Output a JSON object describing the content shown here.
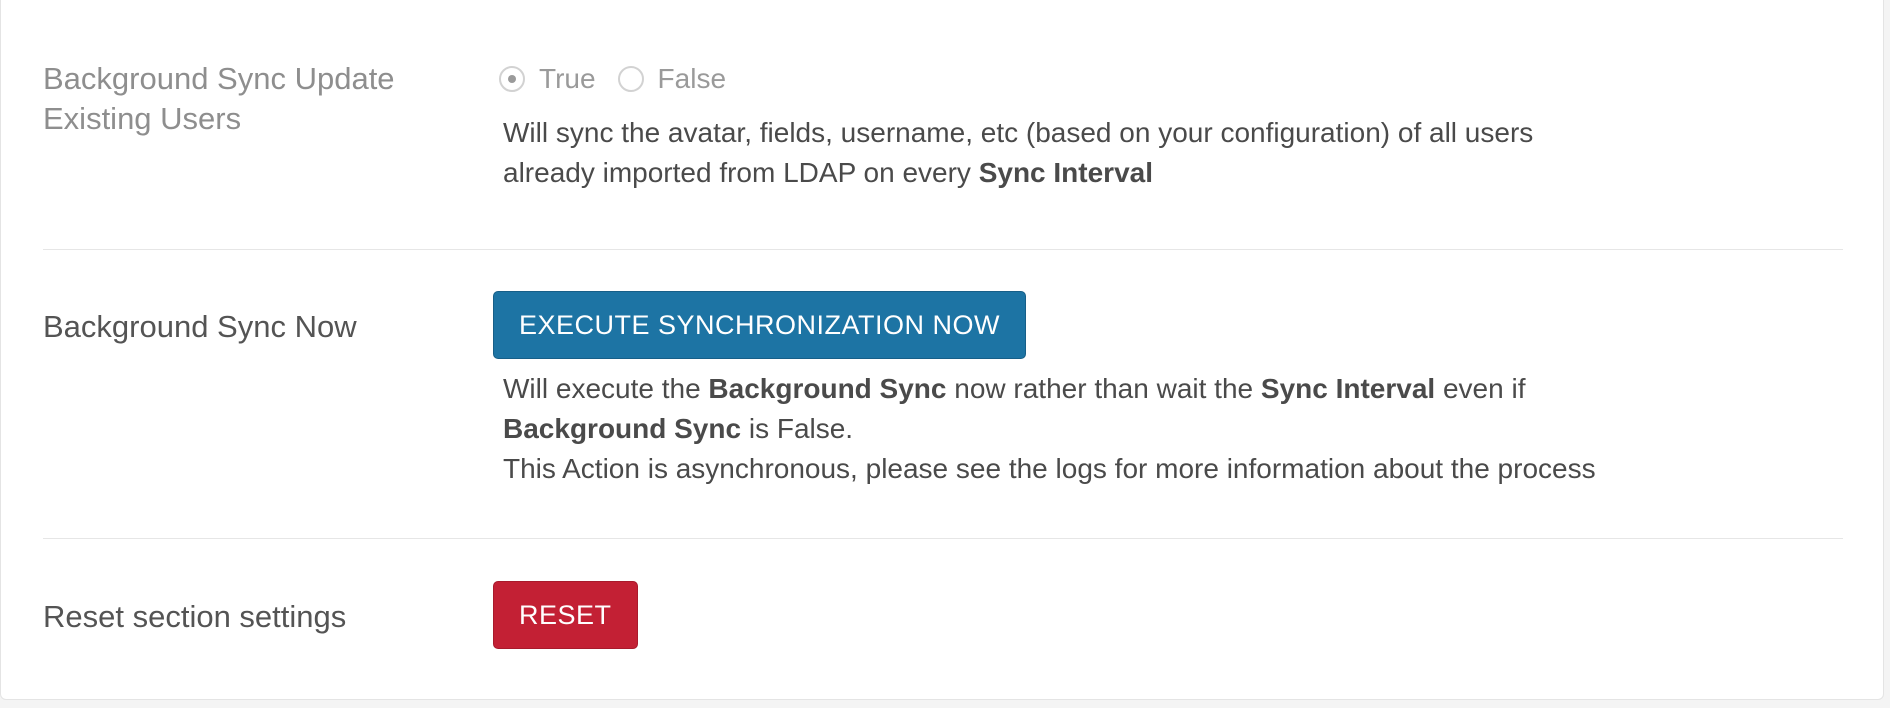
{
  "colors": {
    "primary_button": "#1d74a4",
    "danger_button": "#c32034",
    "divider": "#e6e6e6"
  },
  "sync_update_existing": {
    "label": "Background Sync Update Existing Users",
    "options": [
      {
        "label": "True",
        "selected": true
      },
      {
        "label": "False",
        "selected": false
      }
    ],
    "description_line1": "Will sync the avatar, fields, username, etc (based on your configuration) of all users",
    "description_line2_prefix": "already imported from LDAP on every ",
    "description_line2_bold": "Sync Interval"
  },
  "sync_now": {
    "label": "Background Sync Now",
    "button_label": "EXECUTE SYNCHRONIZATION NOW",
    "desc_part1": "Will execute the ",
    "desc_bold1": "Background Sync",
    "desc_part2": " now rather than wait the ",
    "desc_bold2": "Sync Interval",
    "desc_part3": " even if",
    "desc_bold3": "Background Sync",
    "desc_part4": " is False.",
    "desc_line3": "This Action is asynchronous, please see the logs for more information about the process"
  },
  "reset_section": {
    "label": "Reset section settings",
    "button_label": "RESET"
  }
}
